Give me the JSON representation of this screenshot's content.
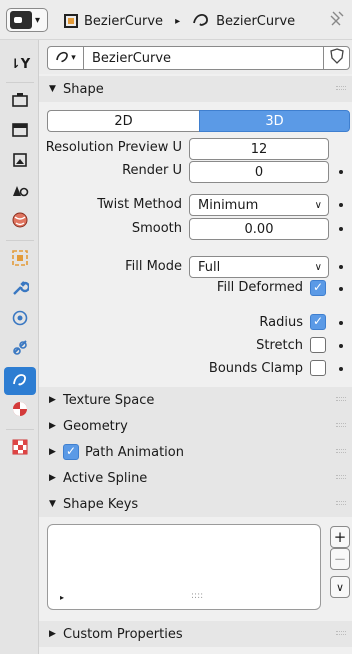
{
  "header": {
    "crumb_object": "BezierCurve",
    "crumb_separator": "▸",
    "crumb_data": "BezierCurve"
  },
  "datablock": {
    "name": "BezierCurve"
  },
  "panels": {
    "shape": "Shape",
    "texture_space": "Texture Space",
    "geometry": "Geometry",
    "path_animation": "Path Animation",
    "active_spline": "Active Spline",
    "shape_keys": "Shape Keys",
    "custom_properties": "Custom Properties"
  },
  "shape": {
    "dim_2d": "2D",
    "dim_3d": "3D",
    "dim_selected": "3D",
    "resolution_preview_u_label": "Resolution Preview U",
    "resolution_preview_u": "12",
    "render_u_label": "Render U",
    "render_u": "0",
    "twist_method_label": "Twist Method",
    "twist_method": "Minimum",
    "smooth_label": "Smooth",
    "smooth": "0.00",
    "fill_mode_label": "Fill Mode",
    "fill_mode": "Full",
    "fill_deformed_label": "Fill Deformed",
    "fill_deformed": true,
    "radius_label": "Radius",
    "radius": true,
    "stretch_label": "Stretch",
    "stretch": false,
    "bounds_clamp_label": "Bounds Clamp",
    "bounds_clamp": false
  },
  "path_animation_enabled": true,
  "shape_keys": {
    "add": "+",
    "remove": "−",
    "menu": "∨",
    "list_expand": "▸",
    "list_grip": "::::"
  },
  "colors": {
    "accent": "#5b9ae6",
    "active_tab": "#2d7dd2",
    "selected_segment": "#5b9ae6"
  },
  "icons": {
    "tool": "tool-icon",
    "render": "render-icon",
    "output": "output-icon",
    "view_layer": "view-layer-icon",
    "scene": "scene-icon",
    "world": "world-icon",
    "object": "object-icon",
    "modifier": "wrench-icon",
    "physics": "physics-icon",
    "constraints": "constraint-icon",
    "data": "curve-icon",
    "material": "material-icon",
    "texture": "texture-icon",
    "pin": "pin-icon",
    "shield": "shield-icon"
  }
}
